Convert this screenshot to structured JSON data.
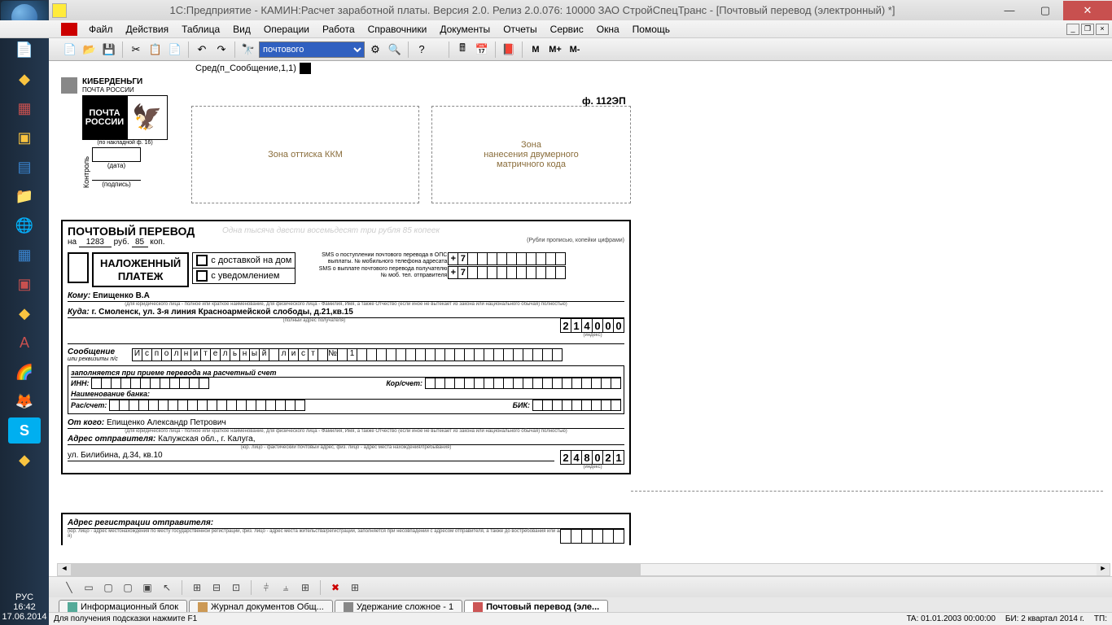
{
  "titlebar": {
    "title": "1С:Предприятие - КАМИН:Расчет заработной платы. Версия 2.0. Релиз 2.0.076: 10000 ЗАО СтройСпецТранс - [Почтовый перевод (электронный)  *]"
  },
  "menu": {
    "items": [
      "Файл",
      "Действия",
      "Таблица",
      "Вид",
      "Операции",
      "Работа",
      "Справочники",
      "Документы",
      "Отчеты",
      "Сервис",
      "Окна",
      "Помощь"
    ]
  },
  "toolbar": {
    "search_value": "почтового"
  },
  "formula": {
    "text": "Сред(п_Сообщение,1,1)"
  },
  "doc": {
    "cyber": "КИБЕРДЕНЬГИ",
    "cyber_sub": "ПОЧТА РОССИИ",
    "logo1": "ПОЧТА",
    "logo2": "РОССИИ",
    "logo_cap": "(по накладной ф. 16)",
    "date_lbl": "(дата)",
    "sign_lbl": "(подпись)",
    "control": "Контроль",
    "zone1": "Зона оттиска ККМ",
    "zone2": "Зона\nнанесения двумерного\nматричного кода",
    "form_num": "ф. 112ЭП"
  },
  "form": {
    "title": "ПОЧТОВЫЙ ПЕРЕВОД",
    "watermark": "Одна тысяча двести восемьдесят три рубля 85 копеек",
    "na": "на",
    "rub_val": "1283",
    "rub": "руб.",
    "kop_val": "85",
    "kop": "коп.",
    "rub_caption": "(Рубли прописью, копейки цифрами)",
    "nalozh1": "НАЛОЖЕННЫЙ",
    "nalozh2": "ПЛАТЕЖ",
    "delivery": "с доставкой на дом",
    "notice": "с уведомлением",
    "sms1": "SMS о поступлении почтового перевода в ОПС\nвыплаты. № мобильного телефона адресата",
    "sms2": "SMS о выплате почтового перевода получателю\n№ моб. тел. отправителя",
    "plus": "+",
    "seven": "7",
    "komu": "Кому:",
    "komu_val": "Епищенко  В.А",
    "komu_cap": "(для юридического лица - полное или краткое наименование, для физического лица - Фамилия, Имя, а также Отчество (если иное не вытекает из закона или национального обычая) полностью)",
    "kuda": "Куда:",
    "kuda_val": "г. Смоленск, ул. 3-я линия Красноармейской слободы, д.21,кв.15",
    "kuda_cap": "(полный адрес получателя)",
    "idx1": [
      "2",
      "1",
      "4",
      "0",
      "0",
      "0"
    ],
    "idx_cap": "(индекс)",
    "msg_lbl": "Сообщение",
    "msg_sub": "или реквизиты п/с",
    "msg_chars": [
      "И",
      "с",
      "п",
      "о",
      "л",
      "н",
      "и",
      "т",
      "е",
      "л",
      "ь",
      "н",
      "ы",
      "й",
      "",
      "л",
      "и",
      "с",
      "т",
      "",
      "№",
      "",
      "1"
    ],
    "bank_title": "заполняется при приеме перевода на расчетный счет",
    "inn": "ИНН:",
    "kor": "Кор/счет:",
    "bank_name": "Наименование банка:",
    "ras": "Рас/счет:",
    "bik": "БИК:",
    "otkogo": "От кого:",
    "otkogo_val": "Епищенко Александр Петрович",
    "otkogo_cap": "(для юридического лица - полное или краткое наименование, для физического лица - Фамилия, Имя, а также Отчество (если иное не вытекает из закона или национального обычая) полностью)",
    "addr_otpr": "Адрес отправителя:",
    "addr_otpr_val": "Калужская обл.,   г. Калуга,",
    "addr_otpr_cap": "(юр. лицо - фактический почтовый адрес, физ. лицо - адрес места нахождения/пребывания)",
    "addr_otpr_val2": "ул. Билибина,  д.34,  кв.10",
    "idx2": [
      "2",
      "4",
      "8",
      "0",
      "2",
      "1"
    ],
    "reg_title": "Адрес регистрации отправителя:",
    "reg_cap": "(юр. лицо - адрес местонахождения по месту государственной регистрации, физ. лицо - адрес места жительства/регистрации, заполняется при несовпадении с адресом отправителя, а также до востребования или а/я)"
  },
  "tabs": [
    {
      "label": "Информационный блок",
      "active": false
    },
    {
      "label": "Журнал документов  Общ...",
      "active": false
    },
    {
      "label": "Удержание сложное - 1",
      "active": false
    },
    {
      "label": "Почтовый перевод (эле...",
      "active": true
    }
  ],
  "statusbar": {
    "hint": "Для получения подсказки нажмите F1",
    "ta": "TA: 01.01.2003  00:00:00",
    "bi": "БИ: 2 квартал 2014 г.",
    "tp": "ТП:"
  },
  "clock": {
    "lang": "РУС",
    "time": "16:42",
    "date": "17.06.2014"
  }
}
